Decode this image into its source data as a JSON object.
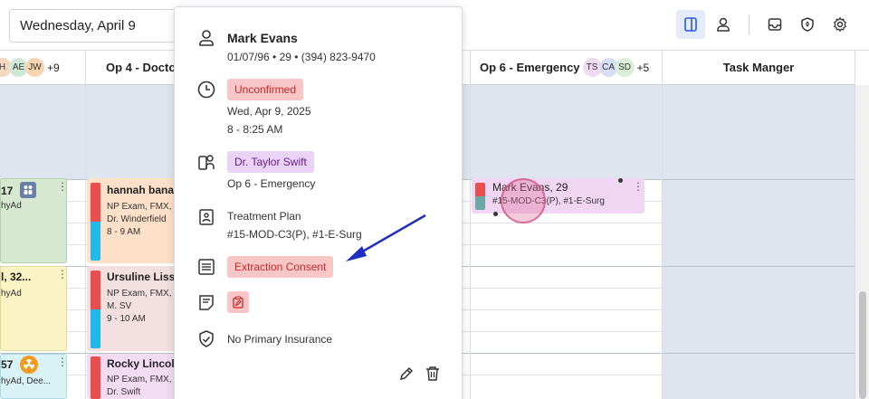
{
  "header": {
    "date": "Wednesday, April 9",
    "icons": [
      "sidebar-panel-icon",
      "user-icon",
      "inbox-icon",
      "shield-icon",
      "gear-icon"
    ]
  },
  "columns": [
    {
      "id": "col1",
      "avatars": [
        {
          "label": "H",
          "color": "#f6d7c0"
        },
        {
          "label": "AE",
          "color": "#cfe9d6"
        },
        {
          "label": "JW",
          "color": "#f8d4b0"
        }
      ],
      "more": "+9"
    },
    {
      "id": "col2",
      "title": "Op 4 - Docto"
    },
    {
      "id": "col3",
      "title": "Op 6 - Emergency",
      "avatars": [
        {
          "label": "TS",
          "color": "#f1dbf1"
        },
        {
          "label": "CA",
          "color": "#d6def5"
        },
        {
          "label": "SD",
          "color": "#dcefd6"
        }
      ],
      "more": "+5"
    },
    {
      "id": "col4",
      "title": "Task Manger"
    }
  ],
  "appointments": {
    "col1": [
      {
        "name": "17",
        "sub": "hyAd",
        "color": "#d6e8cf"
      },
      {
        "name": "l, 32...",
        "sub": "hyAd",
        "color": "#faf3c4"
      },
      {
        "name": "57",
        "sub": "hyAd, Dee...",
        "color": "#d8f2f6"
      }
    ],
    "col2": [
      {
        "name": "hannah bana",
        "sub1": "NP Exam, FMX,",
        "sub2": "Dr. Winderfield",
        "time": "8 - 9 AM",
        "color": "#fde0c8"
      },
      {
        "name": "Ursuline Liss",
        "sub1": "NP Exam, FMX,",
        "sub2": "M. SV",
        "time": "9 - 10 AM",
        "color": "#f3dfe0"
      },
      {
        "name": "Rocky Lincol",
        "sub1": "NP Exam, FMX,",
        "sub2": "Dr. Swift",
        "color": "#f3dbf2"
      }
    ],
    "col3": [
      {
        "name": "Mark Evans, 29",
        "sub": "#15-MOD-C3(P), #1-E-Surg",
        "color": "#f1d6f4"
      }
    ]
  },
  "popover": {
    "patient_name": "Mark Evans",
    "patient_details": "01/07/96 • 29 • (394) 823-9470",
    "status": "Unconfirmed",
    "date": "Wed, Apr 9, 2025",
    "time": "8 - 8:25 AM",
    "provider": "Dr. Taylor Swift",
    "operatory": "Op 6 - Emergency",
    "treatment_label": "Treatment Plan",
    "treatment_codes": "#15-MOD-C3(P), #1-E-Surg",
    "form": "Extraction Consent",
    "insurance": "No Primary Insurance"
  },
  "colors": {
    "accent": "#2b55d6",
    "status_red": "#c62828",
    "chip_red_bg": "#f8c6c6",
    "chip_purple_bg": "#ead3f6",
    "shade": "#dfe5ee"
  }
}
